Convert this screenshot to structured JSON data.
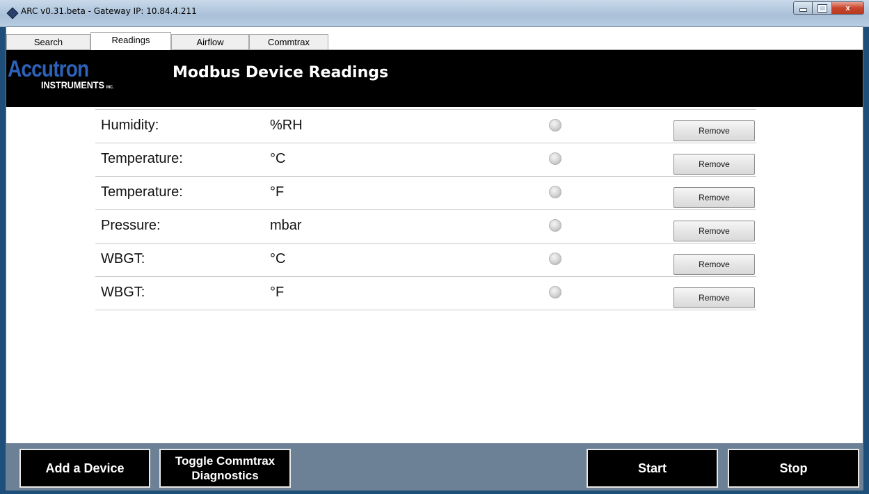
{
  "window": {
    "title": "ARC v0.31.beta - Gateway IP: 10.84.4.211",
    "controls": {
      "minimize_icon": "minimize-icon",
      "maximize_icon": "maximize-icon",
      "close_label": "x"
    }
  },
  "tabs": [
    {
      "label": "Search",
      "active": false
    },
    {
      "label": "Readings",
      "active": true
    },
    {
      "label": "Airflow",
      "active": false
    },
    {
      "label": "Commtrax",
      "active": false
    }
  ],
  "banner": {
    "logo_main": "Accutron",
    "logo_sub": "INSTRUMENTS",
    "logo_inc": "INC.",
    "title": "Modbus Device Readings"
  },
  "readings": [
    {
      "label": "Humidity:",
      "unit": "%RH",
      "button": "Remove"
    },
    {
      "label": "Temperature:",
      "unit": "°C",
      "button": "Remove"
    },
    {
      "label": "Temperature:",
      "unit": "°F",
      "button": "Remove"
    },
    {
      "label": "Pressure:",
      "unit": "mbar",
      "button": "Remove"
    },
    {
      "label": "WBGT:",
      "unit": "°C",
      "button": "Remove"
    },
    {
      "label": "WBGT:",
      "unit": "°F",
      "button": "Remove"
    }
  ],
  "footer": {
    "add_device": "Add a Device",
    "toggle_diagnostics": "Toggle Commtrax\nDiagnostics",
    "start": "Start",
    "stop": "Stop"
  },
  "colors": {
    "banner_bg": "#000000",
    "logo_blue": "#2d62b8",
    "footer_bg": "#6d8196",
    "button_bg": "#000000"
  }
}
